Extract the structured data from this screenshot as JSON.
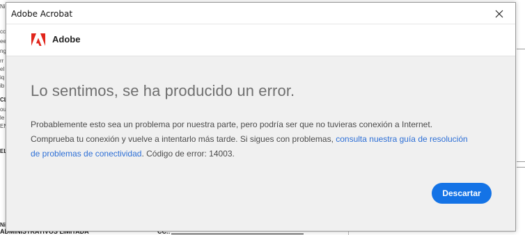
{
  "dialog": {
    "window_title": "Adobe Acrobat",
    "brand_name": "Adobe",
    "heading": "Lo sentimos, se ha producido un error.",
    "message": {
      "before_link": "Probablemente esto sea un problema por nuestra parte, pero podría ser que no tuvieras conexión a Internet. Comprueba tu conexión y vuelve a intentarlo más tarde. Si sigues con problemas, ",
      "link": "consulta nuestra guía de resolución de problemas de conectividad",
      "after_link": ". Código de error: 14003."
    },
    "dismiss_button": "Descartar"
  },
  "colors": {
    "dialog_bg": "#f0f0f0",
    "header_bg": "#ffffff",
    "heading_text": "#6e6e6e",
    "body_text": "#4b4b4b",
    "link": "#2d6fd6",
    "button_bg": "#1473e6",
    "adobe_red": "#e1251b"
  },
  "icons": {
    "close": "close-icon",
    "logo": "adobe-logo-icon"
  },
  "background_document": {
    "left_fragments": [
      "Ni",
      "cc",
      "ee",
      "ng",
      "rr",
      "el",
      "iq",
      "ib",
      "CL",
      "ou",
      "le",
      "EN",
      "EL",
      "Ni"
    ],
    "bottom_text": "ADMINISTRATIVOS LIMITADA",
    "cc_label": "CC.:"
  }
}
